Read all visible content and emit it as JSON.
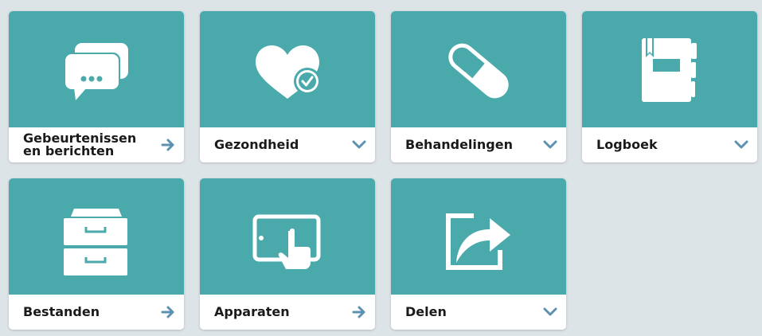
{
  "colors": {
    "background": "#dde4e8",
    "tile_header": "#4aaaab",
    "tile_footer": "#ffffff",
    "label_text": "#1a1a1a",
    "action_icon": "#5b92b0",
    "icon_fill": "#ffffff"
  },
  "tiles": [
    {
      "label": "Gebeurtenissen en berichten",
      "icon": "chat-bubbles-icon",
      "action": "arrow-right-icon"
    },
    {
      "label": "Gezondheid",
      "icon": "heart-check-icon",
      "action": "chevron-down-icon"
    },
    {
      "label": "Behandelingen",
      "icon": "pill-icon",
      "action": "chevron-down-icon"
    },
    {
      "label": "Logboek",
      "icon": "notebook-icon",
      "action": "chevron-down-icon"
    },
    {
      "label": "Bestanden",
      "icon": "file-cabinet-icon",
      "action": "arrow-right-icon"
    },
    {
      "label": "Apparaten",
      "icon": "tablet-touch-icon",
      "action": "arrow-right-icon"
    },
    {
      "label": "Delen",
      "icon": "share-icon",
      "action": "chevron-down-icon"
    }
  ]
}
